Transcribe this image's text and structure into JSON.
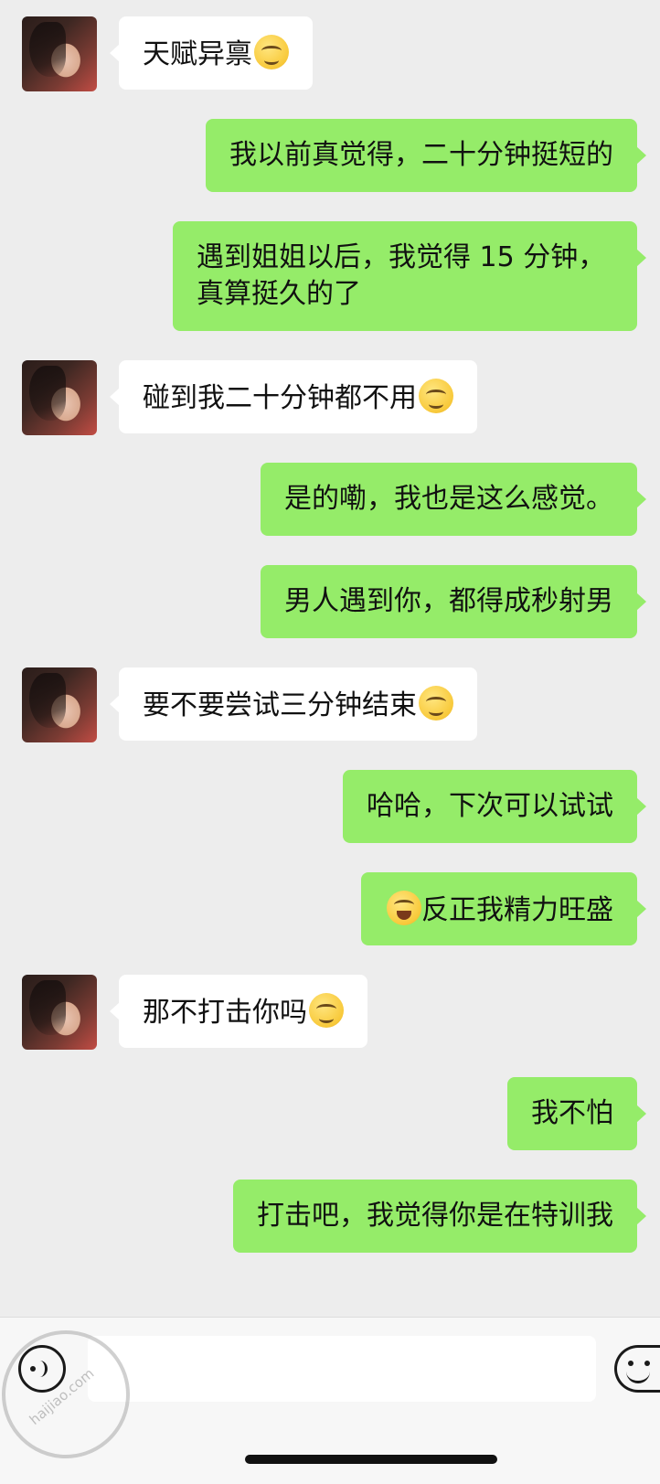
{
  "messages": [
    {
      "side": "in",
      "text": "天赋异禀",
      "emoji": "smirk"
    },
    {
      "side": "out",
      "text": "我以前真觉得，二十分钟挺短的"
    },
    {
      "side": "out",
      "text": "遇到姐姐以后，我觉得 15 分钟，真算挺久的了"
    },
    {
      "side": "in",
      "text": "碰到我二十分钟都不用",
      "emoji": "smirk"
    },
    {
      "side": "out",
      "text": "是的嘞，我也是这么感觉。"
    },
    {
      "side": "out",
      "text": "男人遇到你，都得成秒射男"
    },
    {
      "side": "in",
      "text": "要不要尝试三分钟结束",
      "emoji": "smirk"
    },
    {
      "side": "out",
      "text": "哈哈，下次可以试试"
    },
    {
      "side": "out",
      "text": "反正我精力旺盛",
      "emoji_prefix": "laugh-tears"
    },
    {
      "side": "in",
      "text": "那不打击你吗",
      "emoji": "smirk"
    },
    {
      "side": "out",
      "text": "我不怕"
    },
    {
      "side": "out",
      "text": "打击吧，我觉得你是在特训我"
    }
  ],
  "input": {
    "value": "",
    "placeholder": ""
  },
  "icons": {
    "voice": "voice-icon",
    "emoji": "emoji-icon"
  },
  "watermark": "haijiao.com",
  "colors": {
    "background": "#ededed",
    "outgoing": "#95ec69",
    "incoming": "#ffffff"
  }
}
